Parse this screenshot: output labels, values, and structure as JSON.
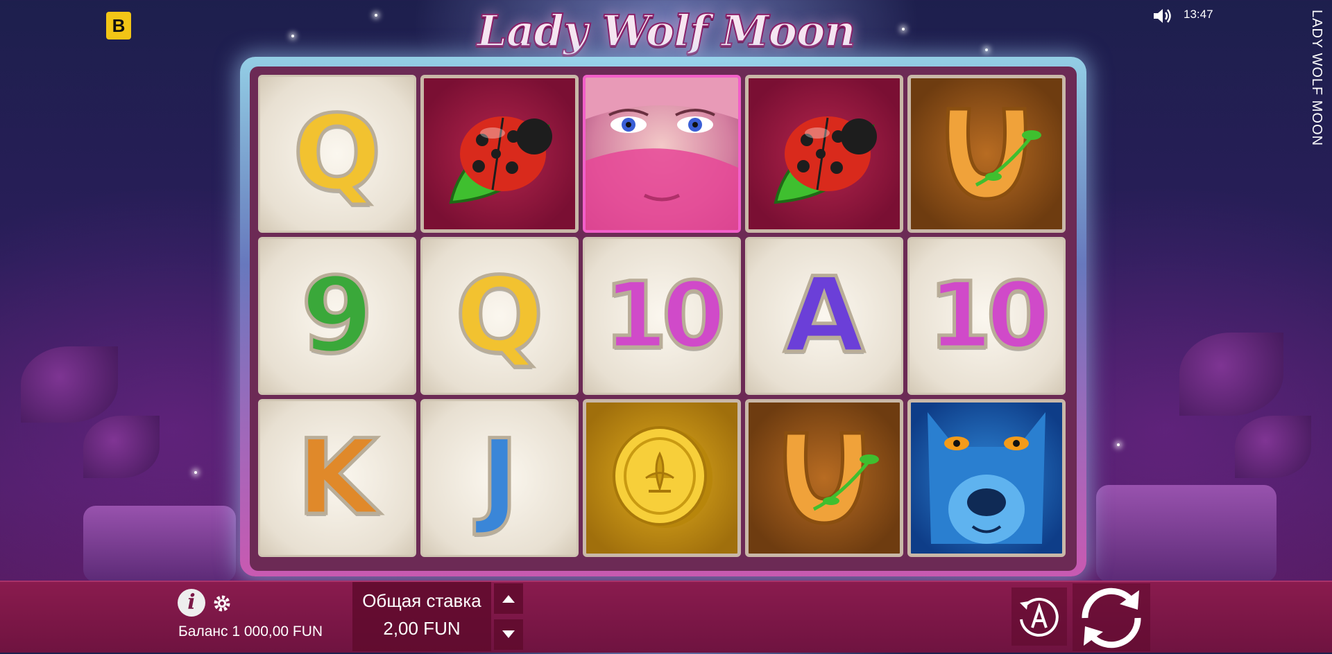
{
  "header": {
    "brand_letter": "B",
    "game_title": "Lady Wolf Moon",
    "clock": "13:47",
    "side_title": "LADY WOLF MOON"
  },
  "icons": [
    "brand-logo",
    "sound-icon",
    "info-icon",
    "gear-icon",
    "arrow-up-icon",
    "arrow-down-icon",
    "autoplay-icon",
    "spin-icon"
  ],
  "reels": {
    "rows": [
      [
        "Q",
        "ladybug",
        "lady",
        "ladybug",
        "horseshoe"
      ],
      [
        "9",
        "Q",
        "10",
        "A",
        "10"
      ],
      [
        "K",
        "J",
        "coin",
        "horseshoe",
        "wolf"
      ]
    ],
    "letter_symbols": [
      {
        "id": "q1",
        "text": "Q",
        "color": "#f2c230"
      },
      {
        "id": "nine",
        "text": "9",
        "color": "#3aa83a"
      },
      {
        "id": "q2",
        "text": "Q",
        "color": "#f2c230"
      },
      {
        "id": "ten1",
        "text": "10",
        "color": "#d04ac9"
      },
      {
        "id": "a",
        "text": "A",
        "color": "#6b3fd8"
      },
      {
        "id": "ten2",
        "text": "10",
        "color": "#d04ac9"
      },
      {
        "id": "k",
        "text": "K",
        "color": "#e0892a"
      },
      {
        "id": "j",
        "text": "J",
        "color": "#3a86d8"
      }
    ]
  },
  "bottom_bar": {
    "balance_text": "Баланс 1 000,00 FUN",
    "bet_label": "Общая ставка",
    "bet_value": "2,00 FUN"
  },
  "colors": {
    "bar": "#7a1746",
    "frame_glow": "#a8dcf5",
    "accent_pink": "#f25fc8",
    "brand_yellow": "#f2c516"
  }
}
